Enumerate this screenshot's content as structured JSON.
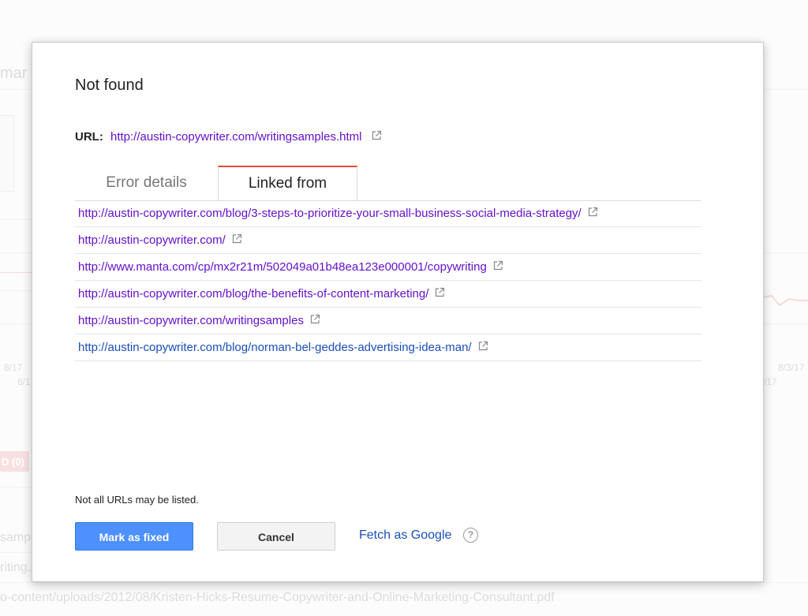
{
  "background": {
    "fragment_top": "mar",
    "date_left_1": "8/17",
    "date_left_2": "6/1",
    "date_right_1": "8/3/17",
    "date_right_2": "/17",
    "badge": "D (0)",
    "fragment_samp": "samp",
    "fragment_riting": "riting.",
    "bottom_url": "o-content/uploads/2012/08/Kristen-Hicks-Resume-Copywriter-and-Online-Marketing-Consultant.pdf"
  },
  "dialog": {
    "title": "Not found",
    "url_label": "URL:",
    "url": "http://austin-copywriter.com/writingsamples.html",
    "tabs": [
      {
        "label": "Error details",
        "active": false
      },
      {
        "label": "Linked from",
        "active": true
      }
    ],
    "linked_from": [
      {
        "url": "http://austin-copywriter.com/blog/3-steps-to-prioritize-your-small-business-social-media-strategy/",
        "visited": true
      },
      {
        "url": "http://austin-copywriter.com/",
        "visited": true
      },
      {
        "url": "http://www.manta.com/cp/mx2r21m/502049a01b48ea123e000001/copywriting",
        "visited": true
      },
      {
        "url": "http://austin-copywriter.com/blog/the-benefits-of-content-marketing/",
        "visited": true
      },
      {
        "url": "http://austin-copywriter.com/writingsamples",
        "visited": true
      },
      {
        "url": "http://austin-copywriter.com/blog/norman-bel-geddes-advertising-idea-man/",
        "visited": false
      }
    ],
    "note": "Not all URLs may be listed.",
    "mark_fixed_label": "Mark as fixed",
    "cancel_label": "Cancel",
    "fetch_label": "Fetch as Google",
    "help_glyph": "?"
  },
  "colors": {
    "visited_link": "#6611cc",
    "link": "#1a4fb8",
    "primary_button": "#4d90fe",
    "active_tab_accent": "#dd4b39"
  },
  "icons": {
    "external_link": "external-link-icon",
    "help": "help-icon"
  }
}
